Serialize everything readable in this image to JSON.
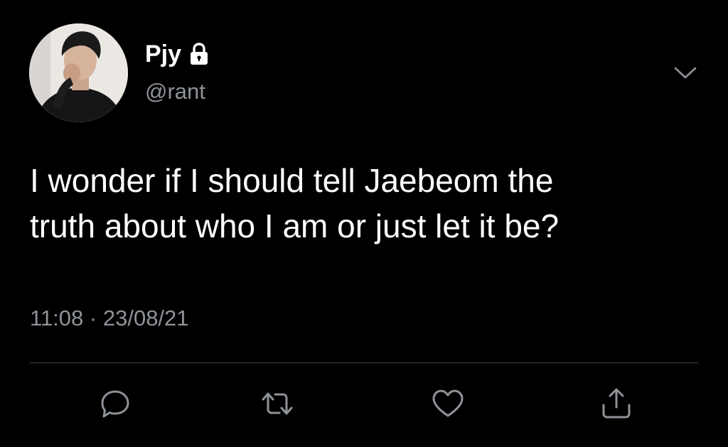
{
  "profile": {
    "display_name": "Pjy",
    "handle": "@rant",
    "protected_icon": "lock-icon",
    "avatar": "profile-photo"
  },
  "menu": {
    "icon": "chevron-down-icon"
  },
  "tweet": {
    "text_lines": [
      "I wonder if I should tell Jaebeom the",
      "truth about who I am or just let it be?"
    ],
    "time": "11:08",
    "separator": "·",
    "date": "23/08/21"
  },
  "actions": [
    {
      "icon": "reply-icon"
    },
    {
      "icon": "retweet-icon"
    },
    {
      "icon": "like-icon"
    },
    {
      "icon": "share-icon"
    }
  ],
  "colors": {
    "background": "#000000",
    "text": "#ffffff",
    "secondary_text": "#8e9399",
    "divider": "#38444d"
  }
}
